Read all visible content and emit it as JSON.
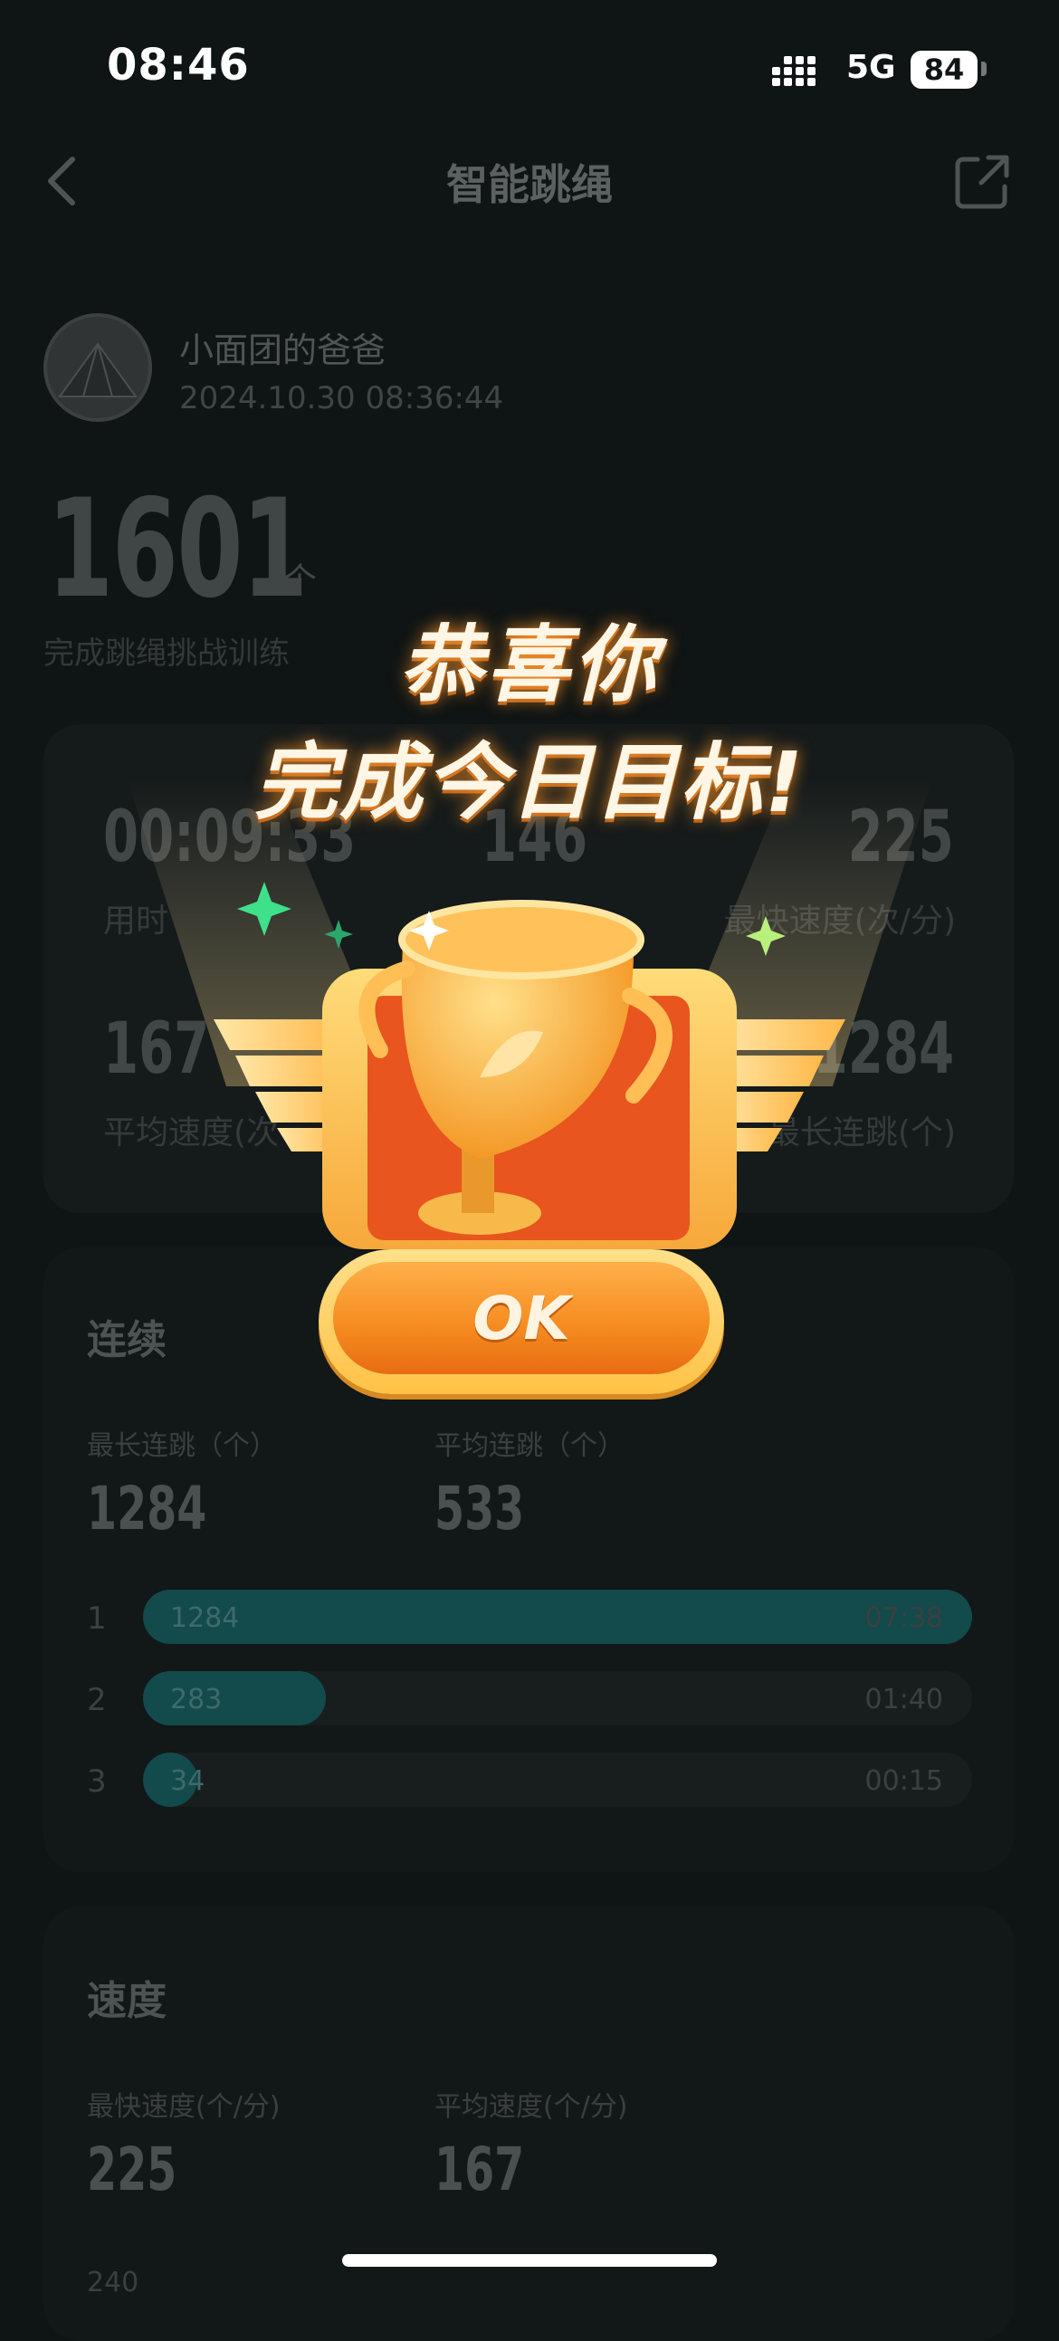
{
  "status_bar": {
    "time": "08:46",
    "network": "5G",
    "battery": "84"
  },
  "nav": {
    "title": "智能跳绳"
  },
  "user": {
    "name": "小面团的爸爸",
    "timestamp": "2024.10.30 08:36:44"
  },
  "summary": {
    "count": "1601",
    "unit": "个",
    "label": "完成跳绳挑战训练"
  },
  "stats": [
    {
      "value": "00:09:33",
      "label": "用时"
    },
    {
      "value": "146",
      "label": ""
    },
    {
      "value": "225",
      "label": "最快速度(次/分)"
    },
    {
      "value": "167",
      "label": "平均速度(次"
    },
    {
      "value": "1284",
      "label": "最长连跳(个)"
    }
  ],
  "streak": {
    "title": "连续",
    "longest_label": "最长连跳（个）",
    "longest_value": "1284",
    "avg_label": "平均连跳（个）",
    "avg_value": "533",
    "bars": [
      {
        "rank": "1",
        "value": "1284",
        "time": "07:38",
        "fraction": 1.0
      },
      {
        "rank": "2",
        "value": "283",
        "time": "01:40",
        "fraction": 0.22
      },
      {
        "rank": "3",
        "value": "34",
        "time": "00:15",
        "fraction": 0.04
      }
    ]
  },
  "speed": {
    "title": "速度",
    "fastest_label": "最快速度(个/分)",
    "fastest_value": "225",
    "avg_label": "平均速度(个/分)",
    "avg_value": "167",
    "axis_top": "240"
  },
  "popup": {
    "title": "恭喜你",
    "subtitle": "完成今日目标!",
    "ok_label": "OK"
  },
  "colors": {
    "accent_orange": "#f58a1f",
    "teal_bar": "#134a4c",
    "background": "#0f1414"
  }
}
